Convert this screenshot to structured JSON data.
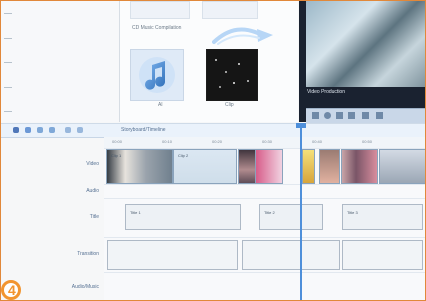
{
  "badge": {
    "number": "4"
  },
  "media": {
    "top_left_label": "CD Music Compilation",
    "music_caption": "Al",
    "dark_caption": "Clip"
  },
  "preview": {
    "caption": "Video Production"
  },
  "toolbar": {
    "title": "Storyboard/Timeline"
  },
  "tracks": [
    {
      "label": "Video",
      "key": "video"
    },
    {
      "label": "Audio",
      "key": "audio"
    },
    {
      "label": "Title",
      "key": "title"
    },
    {
      "label": "Transition",
      "key": "transition"
    },
    {
      "label": "Audio/Music",
      "key": "music"
    }
  ],
  "clips": {
    "video_a": "Clip 1",
    "video_b": "Clip 2",
    "title_a": "Title 1",
    "title_b": "Title 2",
    "title_c": "Title 3"
  },
  "colors": {
    "frame_border": "#e1883a",
    "playhead": "#4e8fda",
    "badge": "#f2942f"
  },
  "icons": {
    "toolbar": [
      "arrow-icon",
      "scissors-icon",
      "undo-icon",
      "redo-icon",
      "zoom-out-icon",
      "zoom-in-icon"
    ],
    "preview_controls": [
      "prev-icon",
      "play-icon",
      "next-icon",
      "stop-icon",
      "split-icon",
      "fullscreen-icon"
    ]
  }
}
